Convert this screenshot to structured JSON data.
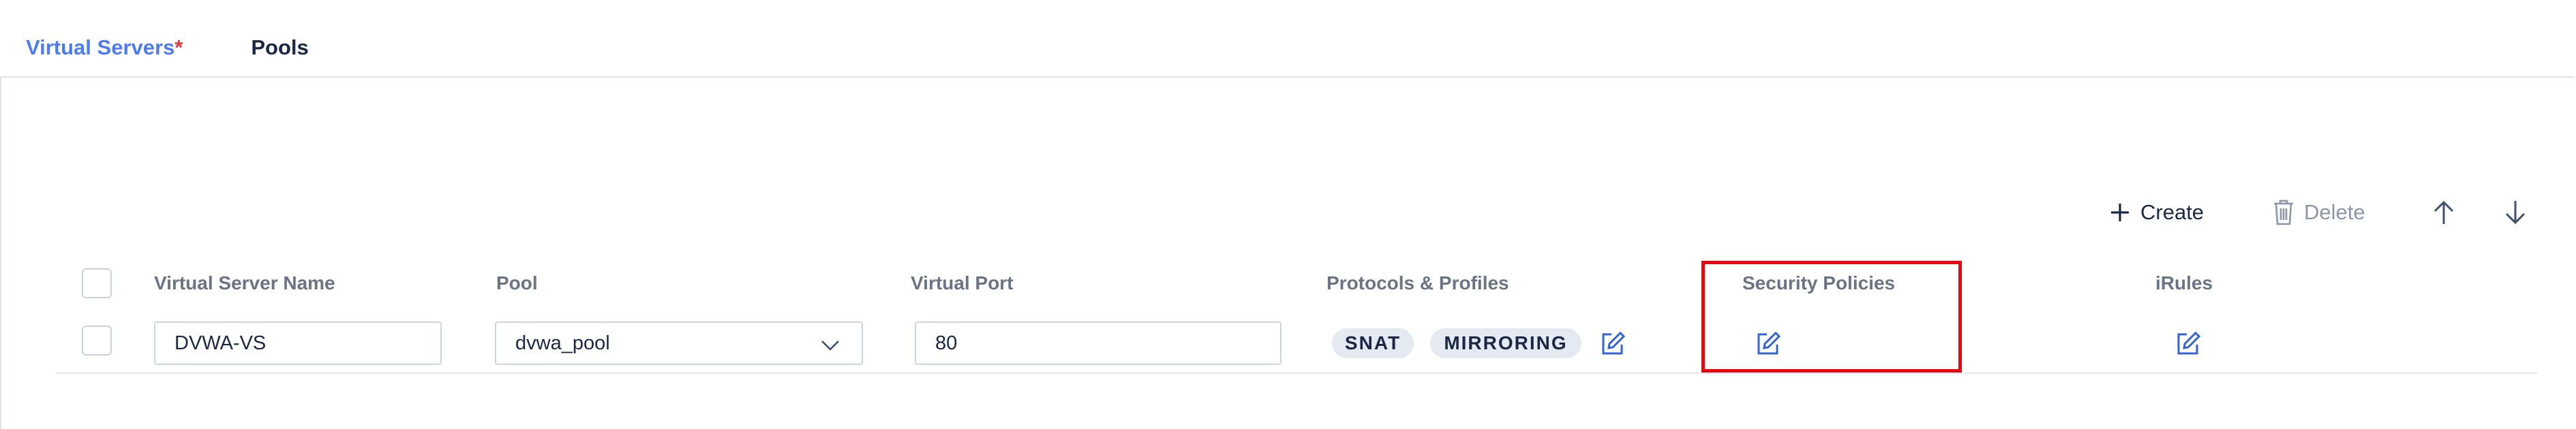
{
  "tabs": {
    "virtual_servers": "Virtual Servers",
    "required_mark": "*",
    "pools": "Pools"
  },
  "toolbar": {
    "create_label": "Create",
    "delete_label": "Delete",
    "create_icon": "plus-icon",
    "delete_icon": "trash-icon",
    "move_up_icon": "arrow-up-icon",
    "move_down_icon": "arrow-down-icon"
  },
  "table": {
    "columns": [
      "Virtual Server Name",
      "Pool",
      "Virtual Port",
      "Protocols & Profiles",
      "Security Policies",
      "iRules"
    ],
    "rows": [
      {
        "name": "DVWA-VS",
        "pool": "dvwa_pool",
        "port": "80",
        "profiles": [
          "SNAT",
          "MIRRORING"
        ]
      }
    ]
  },
  "colors": {
    "accent": "#4d7cf2",
    "required": "#e5383b",
    "highlight": "#e8070d"
  }
}
